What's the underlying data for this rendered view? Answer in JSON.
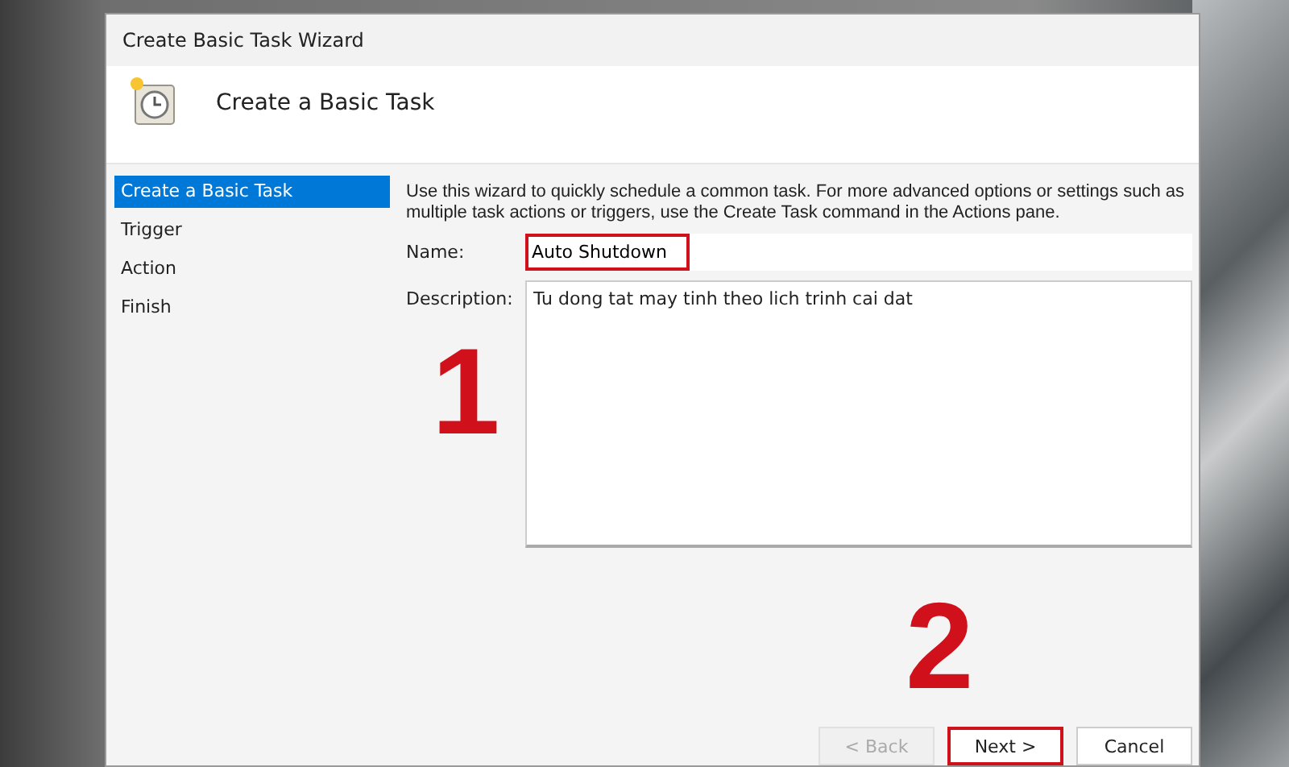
{
  "window": {
    "title": "Create Basic Task Wizard"
  },
  "header": {
    "title": "Create a Basic Task"
  },
  "steps": [
    {
      "label": "Create a Basic Task",
      "selected": true
    },
    {
      "label": "Trigger",
      "selected": false
    },
    {
      "label": "Action",
      "selected": false
    },
    {
      "label": "Finish",
      "selected": false
    }
  ],
  "intro": "Use this wizard to quickly schedule a common task.  For more advanced options or settings such as multiple task actions or triggers, use the Create Task command in the Actions pane.",
  "fields": [
    {
      "kind": "line",
      "label": "Name:",
      "value": "Auto Shutdown",
      "highlighted": true
    },
    {
      "kind": "area",
      "label": "Description:",
      "value": "Tu dong tat may tinh theo lich trinh cai dat",
      "highlighted": false
    }
  ],
  "buttons": [
    {
      "label": "< Back",
      "disabled": true,
      "highlighted": false
    },
    {
      "label": "Next >",
      "disabled": false,
      "highlighted": true
    },
    {
      "label": "Cancel",
      "disabled": false,
      "highlighted": false
    }
  ],
  "annotations": [
    {
      "label": "1"
    },
    {
      "label": "2"
    }
  ]
}
